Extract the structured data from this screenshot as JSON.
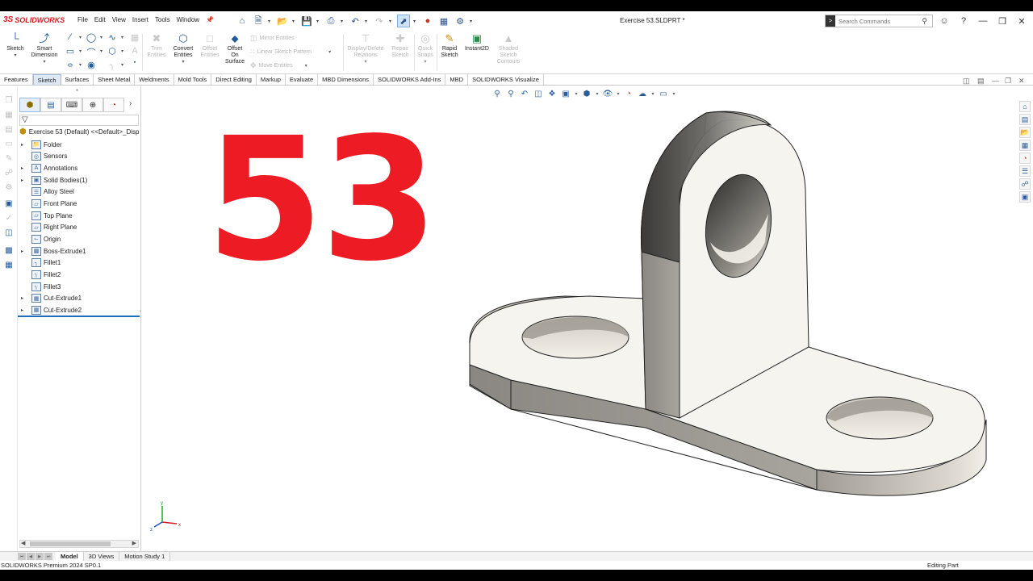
{
  "app": {
    "logo_text": "SOLIDWORKS",
    "logo_mark": "3S",
    "document_title": "Exercise 53.SLDPRT *"
  },
  "menu": [
    "File",
    "Edit",
    "View",
    "Insert",
    "Tools",
    "Window"
  ],
  "search": {
    "placeholder": "Search Commands"
  },
  "ribbon": {
    "sketch": "Sketch",
    "smart_dimension": [
      "Smart",
      "Dimension"
    ],
    "trim_entities": [
      "Trim",
      "Entities"
    ],
    "convert_entities": [
      "Convert",
      "Entities"
    ],
    "offset_entities": [
      "Offset",
      "Entities"
    ],
    "offset_on_surface": [
      "Offset",
      "On",
      "Surface"
    ],
    "mirror_entities": "Mirror Entities",
    "linear_sketch_pattern": "Linear Sketch Pattern",
    "move_entities": "Move Entities",
    "display_delete_relations": [
      "Display/Delete",
      "Relations"
    ],
    "repair_sketch": [
      "Repair",
      "Sketch"
    ],
    "quick_snaps": [
      "Quick",
      "Snaps"
    ],
    "rapid_sketch": [
      "Rapid",
      "Sketch"
    ],
    "instant2d": "Instant2D",
    "shaded_sketch_contours": [
      "Shaded",
      "Sketch",
      "Contours"
    ]
  },
  "tabs": [
    "Features",
    "Sketch",
    "Surfaces",
    "Sheet Metal",
    "Weldments",
    "Mold Tools",
    "Direct Editing",
    "Markup",
    "Evaluate",
    "MBD Dimensions",
    "SOLIDWORKS Add-Ins",
    "MBD",
    "SOLIDWORKS Visualize"
  ],
  "active_tab": "Sketch",
  "feature_tree": {
    "root": "Exercise 53 (Default) <<Default>_Disp",
    "items": [
      {
        "label": "Folder",
        "expandable": true,
        "icon": "folder-icon"
      },
      {
        "label": "Sensors",
        "expandable": false,
        "icon": "sensor-icon"
      },
      {
        "label": "Annotations",
        "expandable": true,
        "icon": "annotation-icon"
      },
      {
        "label": "Solid Bodies(1)",
        "expandable": true,
        "icon": "solid-bodies-icon"
      },
      {
        "label": "Alloy Steel",
        "expandable": false,
        "icon": "material-icon"
      },
      {
        "label": "Front Plane",
        "expandable": false,
        "icon": "plane-icon"
      },
      {
        "label": "Top Plane",
        "expandable": false,
        "icon": "plane-icon"
      },
      {
        "label": "Right Plane",
        "expandable": false,
        "icon": "plane-icon"
      },
      {
        "label": "Origin",
        "expandable": false,
        "icon": "origin-icon"
      },
      {
        "label": "Boss-Extrude1",
        "expandable": true,
        "icon": "extrude-icon"
      },
      {
        "label": "Fillet1",
        "expandable": false,
        "icon": "fillet-icon"
      },
      {
        "label": "Fillet2",
        "expandable": false,
        "icon": "fillet-icon"
      },
      {
        "label": "Fillet3",
        "expandable": false,
        "icon": "fillet-icon"
      },
      {
        "label": "Cut-Extrude1",
        "expandable": true,
        "icon": "cut-extrude-icon"
      },
      {
        "label": "Cut-Extrude2",
        "expandable": true,
        "icon": "cut-extrude-icon"
      }
    ]
  },
  "viewport": {
    "overlay_number": "53",
    "overlay_color": "#ed1c24",
    "model_color": "#f5f3ee"
  },
  "bottom_tabs": [
    "Model",
    "3D Views",
    "Motion Study 1"
  ],
  "active_bottom_tab": "Model",
  "status": {
    "left": "SOLIDWORKS Premium 2024 SP0.1",
    "right": "Editing Part"
  },
  "triad": {
    "x": "x",
    "y": "y",
    "z": "z"
  }
}
